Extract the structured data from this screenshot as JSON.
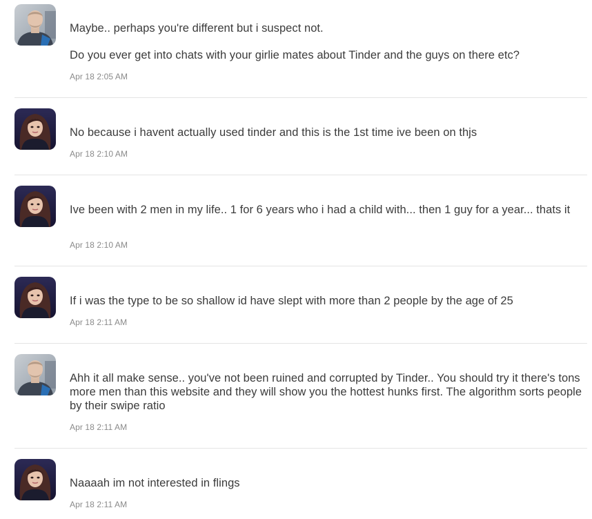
{
  "messages": [
    {
      "sender_icon": "male-avatar-icon",
      "paragraphs": [
        "Maybe.. perhaps you're different but i suspect not.",
        "Do you ever get into chats with your girlie mates about Tinder and the guys on there etc?"
      ],
      "time": "Apr 18 2:05 AM"
    },
    {
      "sender_icon": "female-avatar-icon",
      "paragraphs": [
        "No because i havent actually used tinder and this is the 1st time ive been on thjs"
      ],
      "time": "Apr 18 2:10 AM"
    },
    {
      "sender_icon": "female-avatar-icon",
      "paragraphs": [
        "Ive been with 2 men in my life.. 1 for 6 years who i had a child with... then 1 guy for a year... thats it"
      ],
      "time": "Apr 18 2:10 AM"
    },
    {
      "sender_icon": "female-avatar-icon",
      "paragraphs": [
        "If i was the type to be so shallow id have slept with more than 2 people by the age of 25"
      ],
      "time": "Apr 18 2:11 AM"
    },
    {
      "sender_icon": "male-avatar-icon",
      "paragraphs": [
        "Ahh it all make sense.. you've not been ruined and corrupted by Tinder.. You should try it there's tons more men than this website and they will show you the hottest hunks first. The algorithm sorts people by their swipe ratio"
      ],
      "time": "Apr 18 2:11 AM"
    },
    {
      "sender_icon": "female-avatar-icon",
      "paragraphs": [
        "Naaaah im not interested in flings"
      ],
      "time": "Apr 18 2:11 AM"
    }
  ],
  "colors": {
    "text": "#3b3b3b",
    "timestamp": "#8a8a8a",
    "divider": "#e4e4e4"
  }
}
